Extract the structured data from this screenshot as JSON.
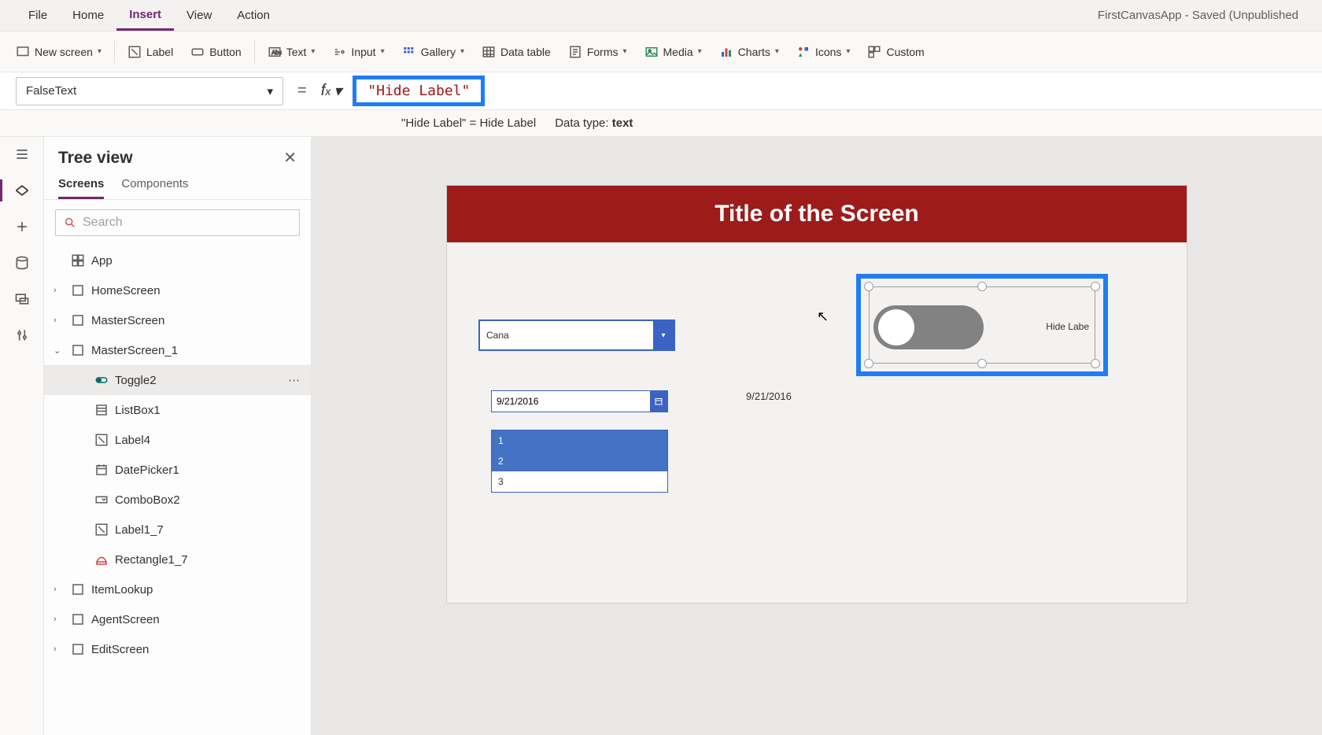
{
  "app_title": "FirstCanvasApp - Saved (Unpublished",
  "menu": {
    "file": "File",
    "home": "Home",
    "insert": "Insert",
    "view": "View",
    "action": "Action"
  },
  "ribbon": {
    "new_screen": "New screen",
    "label": "Label",
    "button": "Button",
    "text": "Text",
    "input": "Input",
    "gallery": "Gallery",
    "data_table": "Data table",
    "forms": "Forms",
    "media": "Media",
    "charts": "Charts",
    "icons": "Icons",
    "custom": "Custom"
  },
  "property_dropdown": "FalseText",
  "formula": "\"Hide Label\"",
  "eval_text": "\"Hide Label\"  =  Hide Label",
  "data_type_label": "Data type: ",
  "data_type_value": "text",
  "treeview": {
    "title": "Tree view",
    "tabs": {
      "screens": "Screens",
      "components": "Components"
    },
    "search_placeholder": "Search",
    "app": "App",
    "nodes": [
      "HomeScreen",
      "MasterScreen",
      "MasterScreen_1",
      "Toggle2",
      "ListBox1",
      "Label4",
      "DatePicker1",
      "ComboBox2",
      "Label1_7",
      "Rectangle1_7",
      "ItemLookup",
      "AgentScreen",
      "EditScreen"
    ]
  },
  "canvas": {
    "title": "Title of the Screen",
    "combo_value": "Cana",
    "date_value": "9/21/2016",
    "date_label": "9/21/2016",
    "list_items": [
      "1",
      "2",
      "3"
    ],
    "toggle_label": "Hide Labe"
  }
}
